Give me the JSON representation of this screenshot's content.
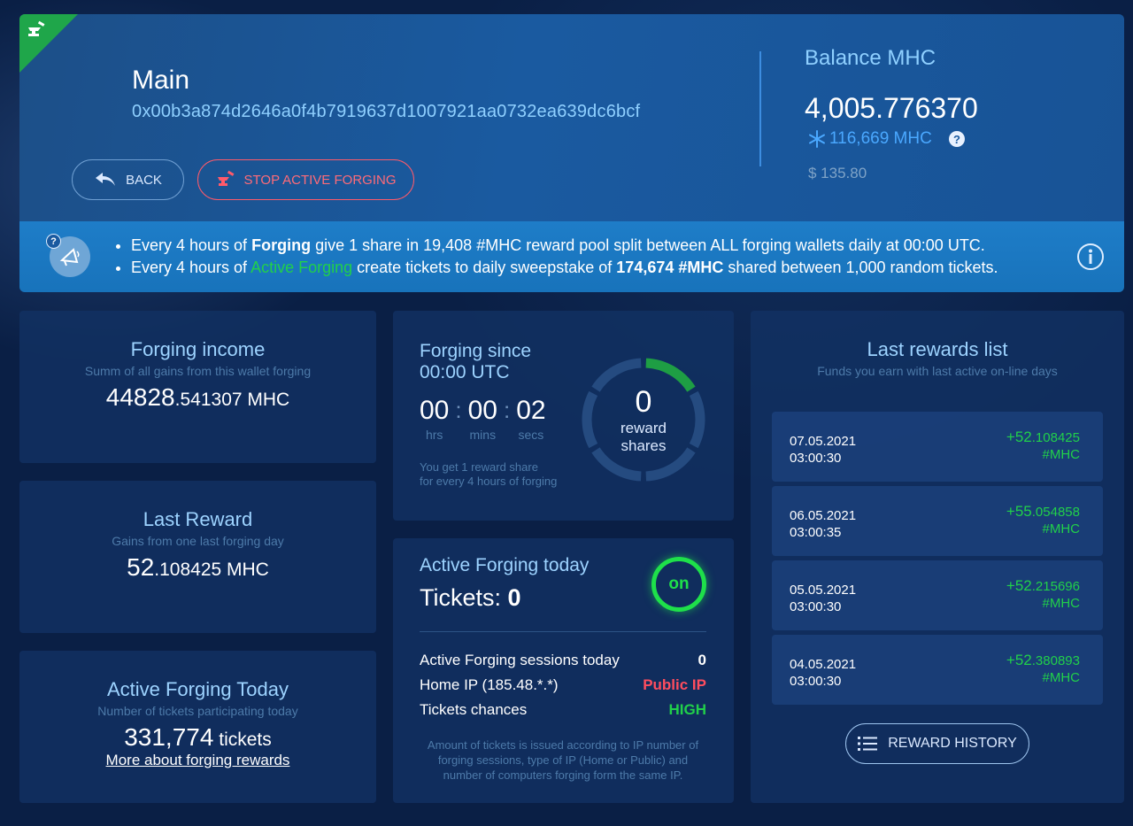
{
  "wallet": {
    "name": "Main",
    "address": "0x00b3a874d2646a0f4b7919637d1007921aa0732ea639dc6bcf"
  },
  "buttons": {
    "back": "BACK",
    "stop": "STOP ACTIVE FORGING",
    "history": "REWARD HISTORY"
  },
  "balance": {
    "label": "Balance MHC",
    "value": "4,005.776370",
    "frozen": "116,669 MHC",
    "usd": "$ 135.80"
  },
  "banner": {
    "line1_a": "Every 4 hours of ",
    "line1_b": "Forging",
    "line1_c": " give 1 share in 19,408 #MHC reward pool split between ALL forging wallets daily at 00:00 UTC.",
    "line2_a": "Every 4 hours of ",
    "line2_b": "Active Forging",
    "line2_c": " create tickets to daily sweepstake of ",
    "line2_d": "174,674 #MHC",
    "line2_e": " shared between 1,000 random tickets."
  },
  "income": {
    "title": "Forging income",
    "sub": "Summ of all gains from this wallet forging",
    "int": "44828",
    "dec": ".541307 MHC"
  },
  "last_reward": {
    "title": "Last Reward",
    "sub": "Gains from one last forging day",
    "int": "52",
    "dec": ".108425 MHC"
  },
  "active_today": {
    "title": "Active Forging Today",
    "sub": "Number of tickets participating today",
    "value": "331,774",
    "unit": " tickets",
    "link": "More about forging rewards"
  },
  "since": {
    "title_1": "Forging since",
    "title_2": "00:00 UTC",
    "hrs": "00",
    "mins": "00",
    "secs": "02",
    "hrs_lbl": "hrs",
    "mins_lbl": "mins",
    "secs_lbl": "secs",
    "sep": ":",
    "note_1": "You get 1 reward share",
    "note_2": "for every 4 hours of forging",
    "shares": "0",
    "shares_lbl_1": "reward",
    "shares_lbl_2": "shares",
    "progress": 0.16
  },
  "active_forging": {
    "title": "Active Forging today",
    "tickets_label": "Tickets: ",
    "tickets": "0",
    "status": "on",
    "rows": [
      {
        "label": "Active Forging sessions today",
        "value": "0"
      },
      {
        "label": "Home IP (185.48.*.*)",
        "value": "Public IP"
      },
      {
        "label": "Tickets chances",
        "value": "HIGH"
      }
    ],
    "note": "Amount of tickets is issued according to IP number of forging sessions, type of IP (Home or Public) and number of computers forging form the same IP."
  },
  "rewards": {
    "title": "Last rewards list",
    "sub": "Funds you earn with last active on-line days",
    "items": [
      {
        "date": "07.05.2021",
        "time": "03:00:30",
        "int": "+52",
        "dec": ".108425",
        "unit": "#MHC"
      },
      {
        "date": "06.05.2021",
        "time": "03:00:35",
        "int": "+55",
        "dec": ".054858",
        "unit": "#MHC"
      },
      {
        "date": "05.05.2021",
        "time": "03:00:30",
        "int": "+52",
        "dec": ".215696",
        "unit": "#MHC"
      },
      {
        "date": "04.05.2021",
        "time": "03:00:30",
        "int": "+52",
        "dec": ".380893",
        "unit": "#MHC"
      }
    ]
  },
  "colors": {
    "accent": "#9dd3ff",
    "green": "#21d04a",
    "red": "#ff4d5e"
  }
}
